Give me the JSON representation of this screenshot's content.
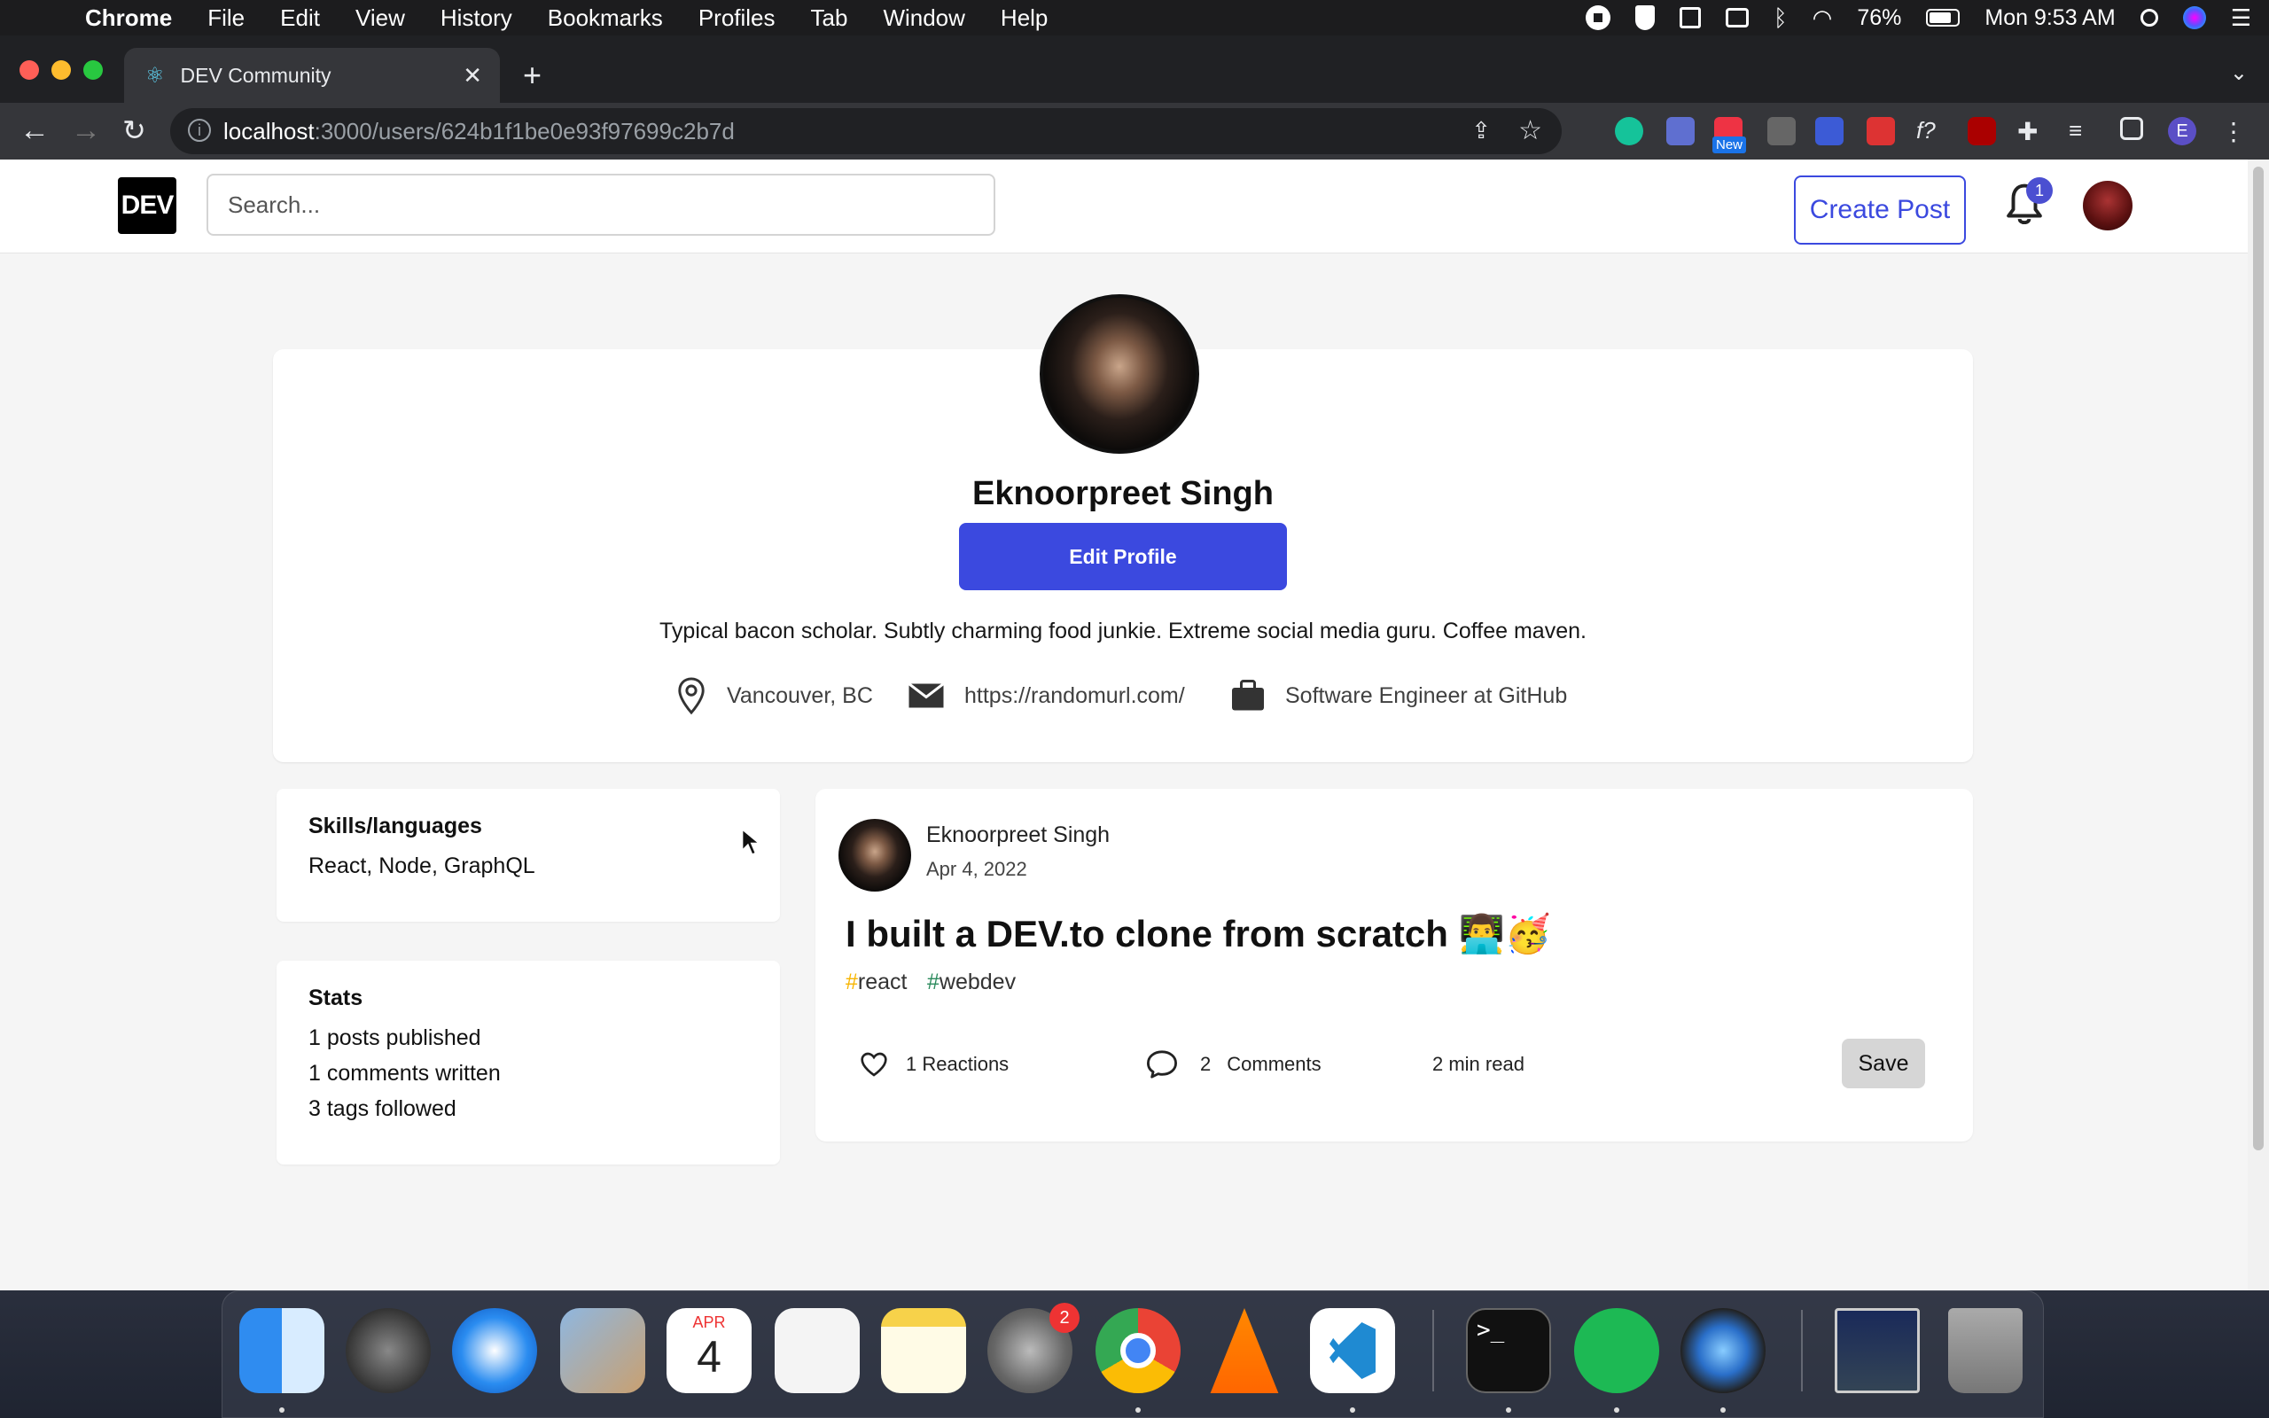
{
  "menubar": {
    "app": "Chrome",
    "items": [
      "File",
      "Edit",
      "View",
      "History",
      "Bookmarks",
      "Profiles",
      "Tab",
      "Window",
      "Help"
    ],
    "battery": "76%",
    "clock": "Mon 9:53 AM"
  },
  "browser": {
    "tab_title": "DEV Community",
    "url_host": "localhost",
    "url_path": ":3000/users/624b1f1be0e93f97699c2b7d",
    "extension_new_badge": "New",
    "profile_initial": "E"
  },
  "header": {
    "logo": "DEV",
    "search_placeholder": "Search...",
    "create_post": "Create Post",
    "notification_count": "1"
  },
  "profile": {
    "name": "Eknoorpreet Singh",
    "edit_button": "Edit Profile",
    "bio": "Typical bacon scholar. Subtly charming food junkie. Extreme social media guru. Coffee maven.",
    "location": "Vancouver, BC",
    "website": "https://randomurl.com/",
    "work": "Software Engineer at GitHub"
  },
  "skills": {
    "heading": "Skills/languages",
    "value": "React, Node, GraphQL"
  },
  "stats": {
    "heading": "Stats",
    "items": [
      "1 posts published",
      "1 comments written",
      "3 tags followed"
    ]
  },
  "post": {
    "author": "Eknoorpreet Singh",
    "date": "Apr 4, 2022",
    "title": "I built a DEV.to clone from scratch 👨‍💻🥳",
    "tags": [
      {
        "name": "react",
        "hash_color": "#f7b500"
      },
      {
        "name": "webdev",
        "hash_color": "#2a8a5c"
      }
    ],
    "reactions": "1 Reactions",
    "comments_count": "2",
    "comments_label": "Comments",
    "read_time": "2 min read",
    "save": "Save"
  },
  "dock": {
    "calendar_month": "APR",
    "calendar_day": "4",
    "settings_badge": "2"
  },
  "colors": {
    "brand": "#3b49df",
    "page_bg": "#f5f5f5"
  }
}
